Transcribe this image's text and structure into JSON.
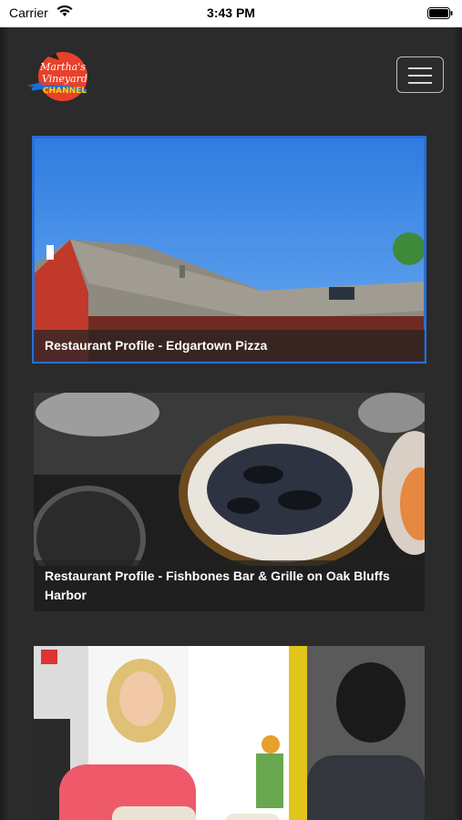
{
  "status_bar": {
    "carrier": "Carrier",
    "time": "3:43 PM"
  },
  "header": {
    "logo_text_line1": "Martha's",
    "logo_text_line2": "Vineyard",
    "logo_text_line3": "CHANNEL",
    "menu_icon": "hamburger-icon"
  },
  "videos": [
    {
      "title": "Restaurant Profile - Edgartown Pizza"
    },
    {
      "title": "Restaurant Profile - Fishbones Bar & Grille on Oak Bluffs Harbor"
    },
    {
      "title": ""
    }
  ],
  "colors": {
    "background": "#2b2b2b",
    "active_outline": "#2a6fd6",
    "logo_red": "#e8402b",
    "logo_yellow": "#f6d21c"
  }
}
